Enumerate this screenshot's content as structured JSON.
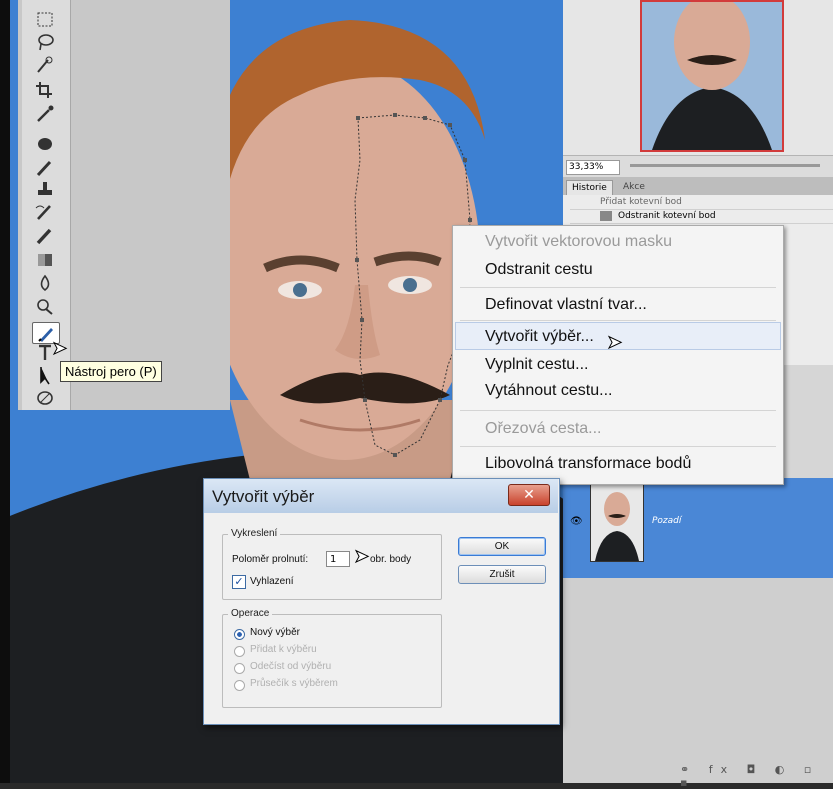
{
  "tools": {
    "tooltip": "Nástroj pero (P)",
    "icons": [
      "marquee-icon",
      "lasso-icon",
      "quick-select-icon",
      "crop-icon",
      "eyedropper-icon",
      "healing-icon",
      "brush-icon",
      "clone-stamp-icon",
      "history-brush-icon",
      "eraser-icon",
      "gradient-icon",
      "blur-icon",
      "dodge-icon",
      "pen-icon",
      "type-icon",
      "path-select-icon",
      "shape-icon"
    ]
  },
  "navigator": {
    "zoom": "33,33%"
  },
  "history": {
    "tabs": [
      "Historie",
      "Akce"
    ],
    "rows": [
      "Přidat kotevní bod",
      "Odstranit kotevní bod"
    ]
  },
  "context_menu": {
    "items": [
      {
        "label": "Vytvořit vektorovou masku",
        "enabled": false
      },
      {
        "label": "Odstranit cestu",
        "enabled": true
      },
      {
        "label": "Definovat vlastní tvar...",
        "enabled": true
      },
      {
        "label": "Vytvořit výběr...",
        "enabled": true,
        "highlighted": true
      },
      {
        "label": "Vyplnit cestu...",
        "enabled": true
      },
      {
        "label": "Vytáhnout cestu...",
        "enabled": true
      },
      {
        "label": "Ořezová cesta...",
        "enabled": false
      },
      {
        "label": "Libovolná transformace bodů",
        "enabled": true
      }
    ]
  },
  "dialog": {
    "title": "Vytvořit výběr",
    "close": "✕",
    "group_render": "Vykreslení",
    "radius_label": "Poloměr prolnutí:",
    "radius_value": "1",
    "radius_unit": "obr. body",
    "antialias_label": "Vyhlazení",
    "antialias_checked": true,
    "group_operation": "Operace",
    "operations": [
      {
        "label": "Nový výběr",
        "selected": true,
        "enabled": true
      },
      {
        "label": "Přidat k výběru",
        "selected": false,
        "enabled": false
      },
      {
        "label": "Odečíst od výběru",
        "selected": false,
        "enabled": false
      },
      {
        "label": "Průsečík s výběrem",
        "selected": false,
        "enabled": false
      }
    ],
    "ok": "OK",
    "reset": "Zrušit"
  },
  "layers": {
    "layer_name": "Pozadí",
    "bottom_icons": "⚭ fx ◘ ◐ ▫ ▪"
  }
}
